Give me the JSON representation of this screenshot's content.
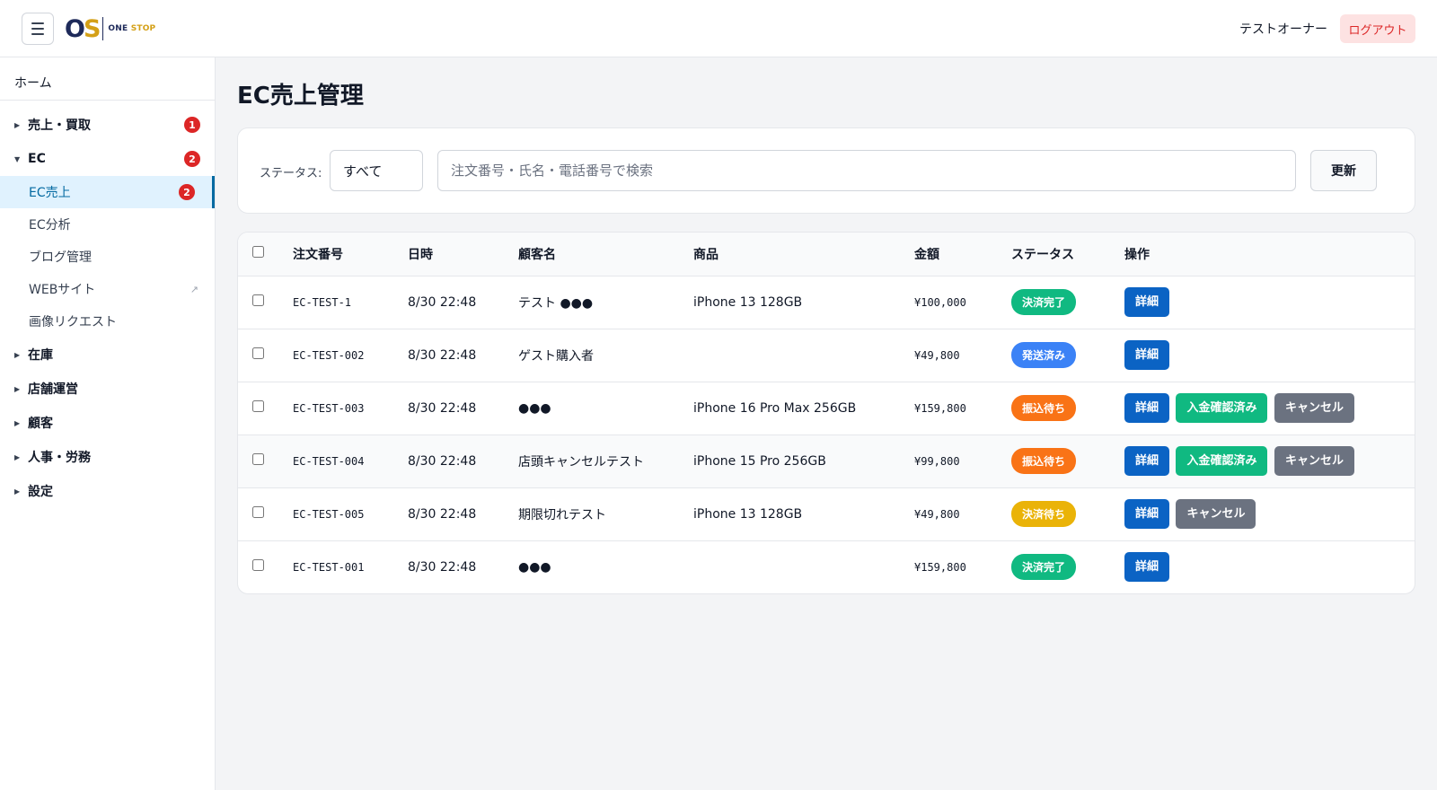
{
  "header": {
    "logo_mark_o": "O",
    "logo_mark_s": "S",
    "logo_text_one": "ONE",
    "logo_text_stop": "STOP",
    "user_name": "テストオーナー",
    "logout_label": "ログアウト"
  },
  "sidebar": {
    "home": "ホーム",
    "sales": {
      "label": "売上・買取",
      "badge": "1"
    },
    "ec": {
      "label": "EC",
      "badge": "2"
    },
    "ec_items": [
      {
        "label": "EC売上",
        "badge": "2"
      },
      {
        "label": "EC分析"
      },
      {
        "label": "ブログ管理"
      },
      {
        "label": "WEBサイト"
      },
      {
        "label": "画像リクエスト"
      }
    ],
    "groups": [
      {
        "label": "在庫"
      },
      {
        "label": "店舗運営"
      },
      {
        "label": "顧客"
      },
      {
        "label": "人事・労務"
      },
      {
        "label": "設定"
      }
    ]
  },
  "main": {
    "title": "EC売上管理",
    "filter": {
      "status_label": "ステータス:",
      "status_value": "すべて",
      "search_placeholder": "注文番号・氏名・電話番号で検索",
      "refresh_label": "更新"
    },
    "table": {
      "columns": [
        "注文番号",
        "日時",
        "顧客名",
        "商品",
        "金額",
        "ステータス",
        "操作"
      ],
      "action_labels": {
        "detail": "詳細",
        "confirm": "入金確認済み",
        "cancel": "キャンセル"
      },
      "rows": [
        {
          "order": "EC-TEST-1",
          "date": "8/30 22:48",
          "customer": "テスト ●●●",
          "product": "iPhone 13 128GB",
          "amount": "¥100,000",
          "status": "決済完了"
        },
        {
          "order": "EC-TEST-002",
          "date": "8/30 22:48",
          "customer": "ゲスト購入者",
          "product": "",
          "amount": "¥49,800",
          "status": "発送済み"
        },
        {
          "order": "EC-TEST-003",
          "date": "8/30 22:48",
          "customer": "●●●",
          "product": "iPhone 16 Pro Max 256GB",
          "amount": "¥159,800",
          "status": "振込待ち"
        },
        {
          "order": "EC-TEST-004",
          "date": "8/30 22:48",
          "customer": "店頭キャンセルテスト",
          "product": "iPhone 15 Pro 256GB",
          "amount": "¥99,800",
          "status": "振込待ち"
        },
        {
          "order": "EC-TEST-005",
          "date": "8/30 22:48",
          "customer": "期限切れテスト",
          "product": "iPhone 13 128GB",
          "amount": "¥49,800",
          "status": "決済待ち"
        },
        {
          "order": "EC-TEST-001",
          "date": "8/30 22:48",
          "customer": "●●●",
          "product": "",
          "amount": "¥159,800",
          "status": "決済完了"
        }
      ]
    }
  },
  "colors": {
    "status_complete": "#10b981",
    "status_shipped": "#3b82f6",
    "status_transfer": "#f97316",
    "status_pending": "#eab308",
    "badge": "#dc2626",
    "accent": "#0369a1"
  }
}
